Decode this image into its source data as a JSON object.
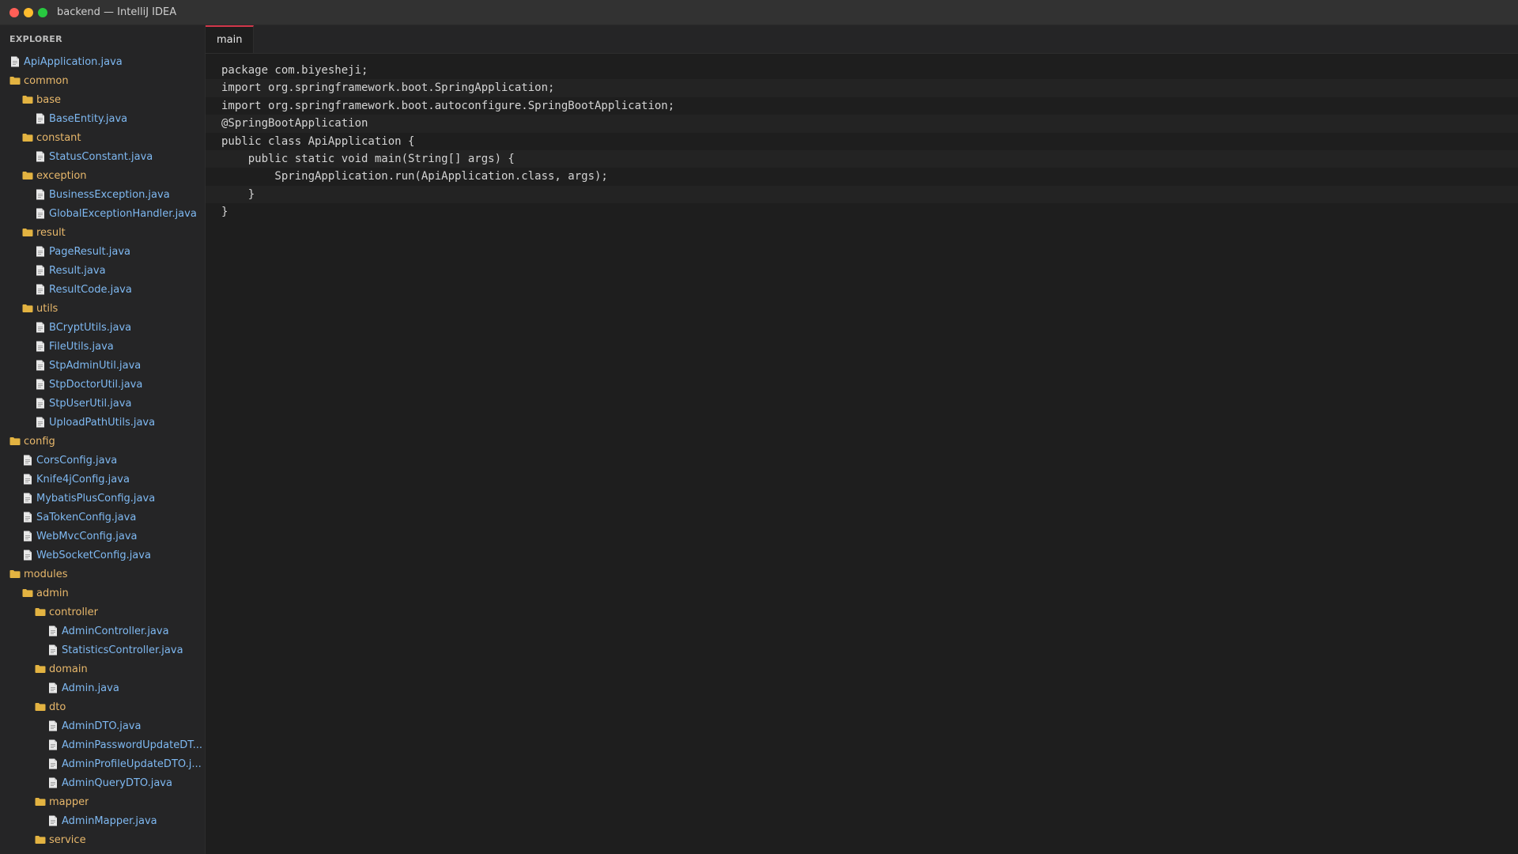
{
  "window": {
    "title": "backend — IntelliJ IDEA",
    "controls": [
      {
        "name": "close-dot",
        "color": "#ff5f57"
      },
      {
        "name": "minimize-dot",
        "color": "#febc2e"
      },
      {
        "name": "zoom-dot",
        "color": "#28c840"
      }
    ]
  },
  "sidebar": {
    "header": "EXPLORER",
    "items": [
      {
        "label": "ApiApplication.java",
        "type": "file",
        "depth": 0
      },
      {
        "label": "common",
        "type": "folder",
        "depth": 0
      },
      {
        "label": "base",
        "type": "folder",
        "depth": 1
      },
      {
        "label": "BaseEntity.java",
        "type": "file",
        "depth": 2
      },
      {
        "label": "constant",
        "type": "folder",
        "depth": 1
      },
      {
        "label": "StatusConstant.java",
        "type": "file",
        "depth": 2
      },
      {
        "label": "exception",
        "type": "folder",
        "depth": 1
      },
      {
        "label": "BusinessException.java",
        "type": "file",
        "depth": 2
      },
      {
        "label": "GlobalExceptionHandler.java",
        "type": "file",
        "depth": 2
      },
      {
        "label": "result",
        "type": "folder",
        "depth": 1
      },
      {
        "label": "PageResult.java",
        "type": "file",
        "depth": 2
      },
      {
        "label": "Result.java",
        "type": "file",
        "depth": 2
      },
      {
        "label": "ResultCode.java",
        "type": "file",
        "depth": 2
      },
      {
        "label": "utils",
        "type": "folder",
        "depth": 1
      },
      {
        "label": "BCryptUtils.java",
        "type": "file",
        "depth": 2
      },
      {
        "label": "FileUtils.java",
        "type": "file",
        "depth": 2
      },
      {
        "label": "StpAdminUtil.java",
        "type": "file",
        "depth": 2
      },
      {
        "label": "StpDoctorUtil.java",
        "type": "file",
        "depth": 2
      },
      {
        "label": "StpUserUtil.java",
        "type": "file",
        "depth": 2
      },
      {
        "label": "UploadPathUtils.java",
        "type": "file",
        "depth": 2
      },
      {
        "label": "config",
        "type": "folder",
        "depth": 0
      },
      {
        "label": "CorsConfig.java",
        "type": "file",
        "depth": 1
      },
      {
        "label": "Knife4jConfig.java",
        "type": "file",
        "depth": 1
      },
      {
        "label": "MybatisPlusConfig.java",
        "type": "file",
        "depth": 1
      },
      {
        "label": "SaTokenConfig.java",
        "type": "file",
        "depth": 1
      },
      {
        "label": "WebMvcConfig.java",
        "type": "file",
        "depth": 1
      },
      {
        "label": "WebSocketConfig.java",
        "type": "file",
        "depth": 1
      },
      {
        "label": "modules",
        "type": "folder",
        "depth": 0
      },
      {
        "label": "admin",
        "type": "folder",
        "depth": 1
      },
      {
        "label": "controller",
        "type": "folder",
        "depth": 2
      },
      {
        "label": "AdminController.java",
        "type": "file",
        "depth": 3
      },
      {
        "label": "StatisticsController.java",
        "type": "file",
        "depth": 3
      },
      {
        "label": "domain",
        "type": "folder",
        "depth": 2
      },
      {
        "label": "Admin.java",
        "type": "file",
        "depth": 3
      },
      {
        "label": "dto",
        "type": "folder",
        "depth": 2
      },
      {
        "label": "AdminDTO.java",
        "type": "file",
        "depth": 3
      },
      {
        "label": "AdminPasswordUpdateDT...",
        "type": "file",
        "depth": 3
      },
      {
        "label": "AdminProfileUpdateDTO.j...",
        "type": "file",
        "depth": 3
      },
      {
        "label": "AdminQueryDTO.java",
        "type": "file",
        "depth": 3
      },
      {
        "label": "mapper",
        "type": "folder",
        "depth": 2
      },
      {
        "label": "AdminMapper.java",
        "type": "file",
        "depth": 3
      },
      {
        "label": "service",
        "type": "folder",
        "depth": 2
      }
    ]
  },
  "editor": {
    "tab_label": "main",
    "lines": [
      "package com.biyesheji;",
      "import org.springframework.boot.SpringApplication;",
      "import org.springframework.boot.autoconfigure.SpringBootApplication;",
      "@SpringBootApplication",
      "public class ApiApplication {",
      "    public static void main(String[] args) {",
      "        SpringApplication.run(ApiApplication.class, args);",
      "    }",
      "}"
    ]
  },
  "colors": {
    "folder_label": "#e8b86b",
    "file_label": "#7fb9f2",
    "folder_icon": "#e3b341",
    "file_icon": "#e8e8e8",
    "tab_accent": "#d2374b"
  }
}
